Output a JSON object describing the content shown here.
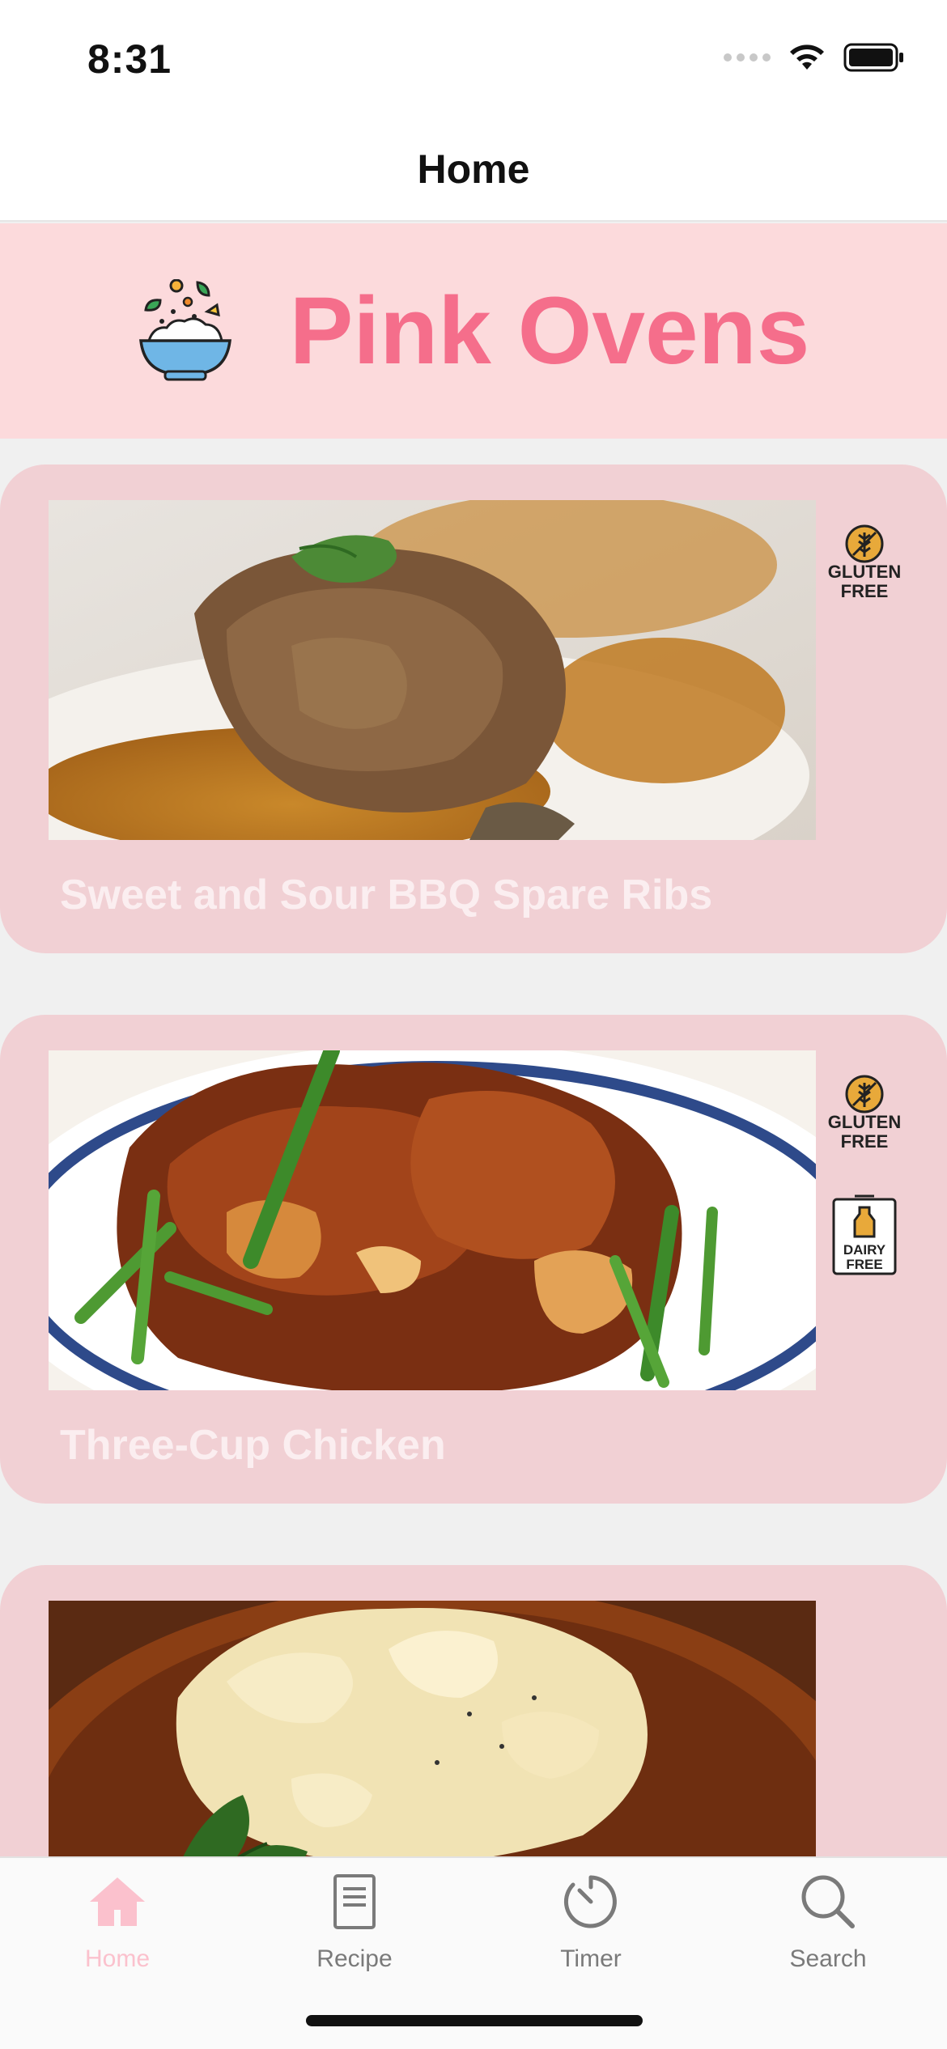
{
  "status_bar": {
    "time": "8:31"
  },
  "nav": {
    "title": "Home"
  },
  "banner": {
    "title": "Pink Ovens",
    "logo_icon": "salad-bowl-icon"
  },
  "colors": {
    "brand_pink": "#f56e8b",
    "banner_bg": "#fcdadc",
    "card_bg": "#f1d0d4",
    "tab_active": "#fbc1cd"
  },
  "recipes": [
    {
      "name": "Sweet and Sour BBQ Spare Ribs",
      "badges": [
        {
          "top": "GLUTEN",
          "bottom": "FREE"
        }
      ]
    },
    {
      "name": "Three-Cup Chicken",
      "badges": [
        {
          "top": "GLUTEN",
          "bottom": "FREE"
        },
        {
          "top": "DAIRY",
          "bottom": "FREE"
        }
      ]
    },
    {
      "name": "",
      "badges": []
    }
  ],
  "tabs": [
    {
      "label": "Home",
      "icon": "home-icon",
      "active": true
    },
    {
      "label": "Recipe",
      "icon": "document-icon",
      "active": false
    },
    {
      "label": "Timer",
      "icon": "timer-icon",
      "active": false
    },
    {
      "label": "Search",
      "icon": "search-icon",
      "active": false
    }
  ]
}
